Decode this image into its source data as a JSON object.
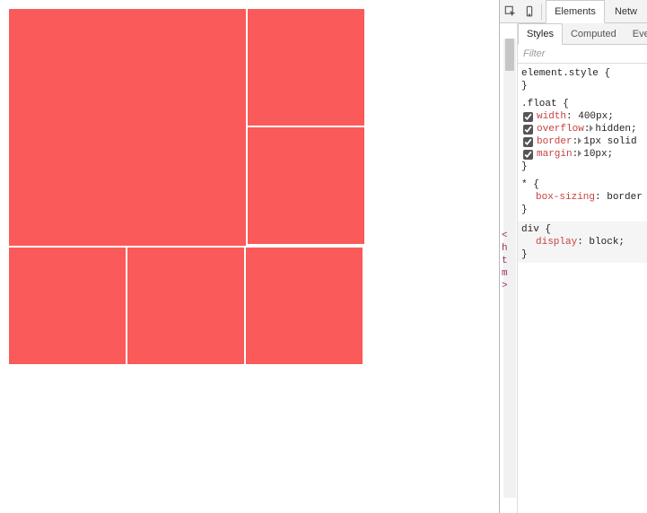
{
  "toolbar": {
    "inspect_icon": "inspect",
    "device_icon": "device",
    "tabs": [
      "Elements",
      "Netw"
    ],
    "active_tab": 0
  },
  "sub_tabs": {
    "items": [
      "Styles",
      "Computed",
      "Eve"
    ],
    "active": 0
  },
  "filter": {
    "placeholder": "Filter"
  },
  "gutter": {
    "tag0": "<",
    "tag1": "h",
    "tag2": "t",
    "tag3": "m",
    "tag4": ">"
  },
  "rules": [
    {
      "selector": "element.style",
      "open": "{",
      "close": "}",
      "decls": []
    },
    {
      "selector": ".float",
      "open": "{",
      "close": "}",
      "decls": [
        {
          "prop": "width",
          "sep": ": ",
          "tri": false,
          "val": "400px;",
          "editing": true
        },
        {
          "prop": "overflow",
          "sep": ":",
          "tri": true,
          "val": "hidden;",
          "editing": false
        },
        {
          "prop": "border",
          "sep": ":",
          "tri": true,
          "val": "1px solid",
          "editing": false
        },
        {
          "prop": "margin",
          "sep": ":",
          "tri": true,
          "val": "10px;",
          "editing": false
        }
      ]
    },
    {
      "selector": "*",
      "open": "{",
      "close": "}",
      "decls": [
        {
          "prop": "box-sizing",
          "sep": ": ",
          "tri": false,
          "val": "border",
          "editing": false,
          "nocb": true
        }
      ]
    },
    {
      "selector": "div",
      "open": "{",
      "close": "}",
      "ua": true,
      "decls": [
        {
          "prop": "display",
          "sep": ": ",
          "tri": false,
          "val": "block;",
          "editing": false,
          "nocb": true
        }
      ]
    }
  ],
  "page": {
    "color": "#fa5a5a"
  }
}
